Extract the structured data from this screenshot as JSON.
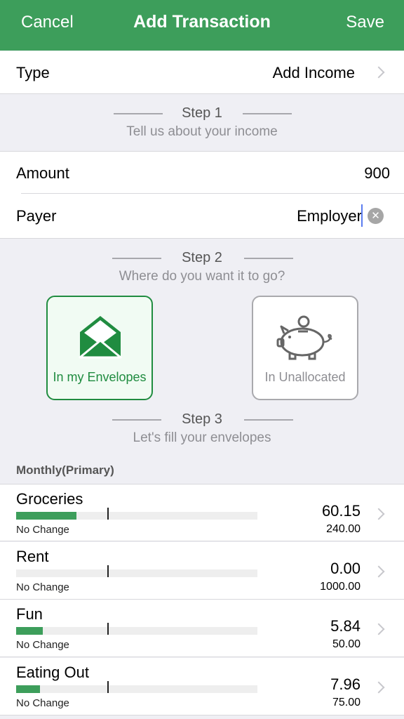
{
  "nav": {
    "cancel": "Cancel",
    "title": "Add Transaction",
    "save": "Save"
  },
  "type_row": {
    "label": "Type",
    "value": "Add Income"
  },
  "step1": {
    "head": "Step 1",
    "sub": "Tell us about your income"
  },
  "amount_row": {
    "label": "Amount",
    "value": "900"
  },
  "payer_row": {
    "label": "Payer",
    "value": "Employer"
  },
  "step2": {
    "head": "Step 2",
    "sub": "Where do you want it to go?"
  },
  "choices": {
    "envelopes": "In my Envelopes",
    "unallocated": "In Unallocated"
  },
  "step3": {
    "head": "Step 3",
    "sub": "Let's fill your envelopes"
  },
  "section": "Monthly(Primary)",
  "envelopes": [
    {
      "name": "Groceries",
      "change": "No Change",
      "amount": "60.15",
      "budget": "240.00",
      "fill_fraction": 0.25
    },
    {
      "name": "Rent",
      "change": "No Change",
      "amount": "0.00",
      "budget": "1000.00",
      "fill_fraction": 0
    },
    {
      "name": "Fun",
      "change": "No Change",
      "amount": "5.84",
      "budget": "50.00",
      "fill_fraction": 0.11
    },
    {
      "name": "Eating Out",
      "change": "No Change",
      "amount": "7.96",
      "budget": "75.00",
      "fill_fraction": 0.1
    }
  ],
  "colors": {
    "brand": "#3d9e5b",
    "selected": "#208c40",
    "clear_button": "#a6a6a6"
  }
}
